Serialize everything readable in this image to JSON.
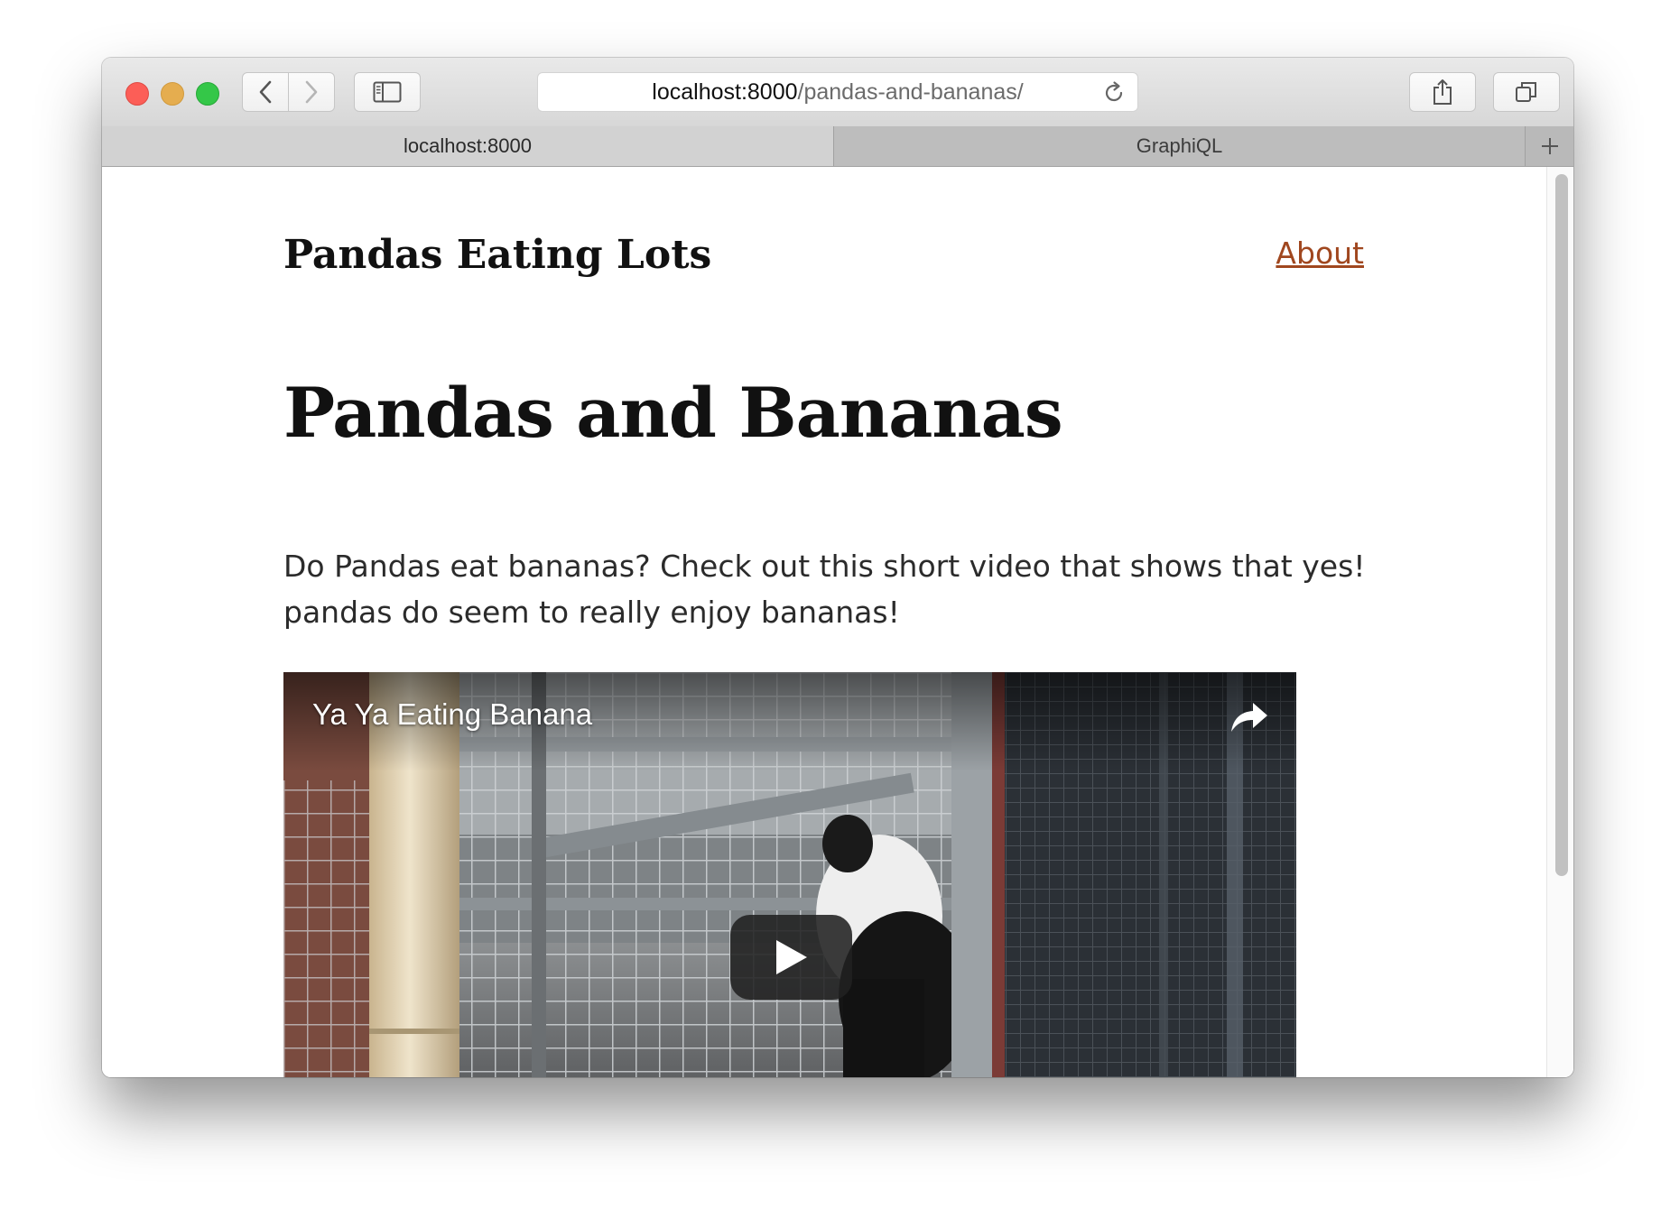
{
  "browser": {
    "url_host": "localhost:8000",
    "url_path": "/pandas-and-bananas/",
    "tabs": [
      {
        "label": "localhost:8000",
        "active": true
      },
      {
        "label": "GraphiQL",
        "active": false
      }
    ],
    "icons": {
      "back": "chevron-left-icon",
      "forward": "chevron-right-icon",
      "sidebar": "sidebar-icon",
      "reload": "reload-icon",
      "share": "share-icon",
      "tabs_overview": "tabs-overview-icon",
      "new_tab": "plus-icon"
    },
    "colors": {
      "close": "#fc5e57",
      "minimize": "#e5ad4f",
      "maximize": "#34c748"
    }
  },
  "page": {
    "site_title": "Pandas Eating Lots",
    "nav_about": "About",
    "post_title": "Pandas and Bananas",
    "post_body": "Do Pandas eat bananas? Check out this short video that shows that yes! pandas do seem to really enjoy bananas!",
    "video": {
      "title": "Ya Ya Eating Banana",
      "share_icon": "share-arrow-icon",
      "play_icon": "play-icon"
    },
    "colors": {
      "link": "#a0471f",
      "text": "#111111"
    }
  }
}
